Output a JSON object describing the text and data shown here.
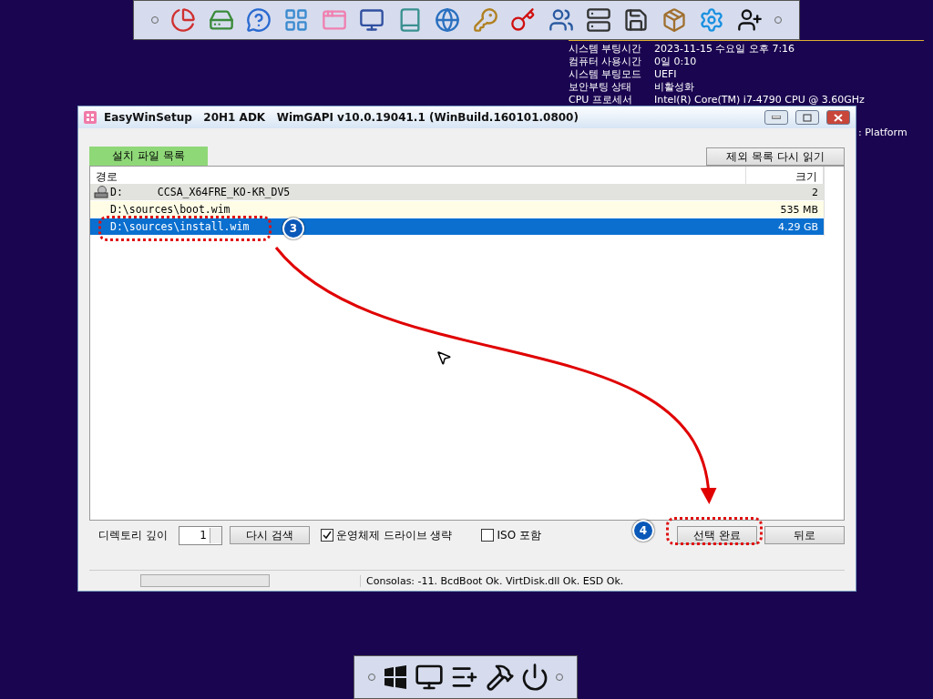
{
  "system_info": [
    {
      "label": "시스템 부팅시간",
      "value": "2023-11-15 수요일 오후 7:16"
    },
    {
      "label": "컴퓨터 사용시간",
      "value": "0일 0:10"
    },
    {
      "label": "시스템 부팅모드",
      "value": "UEFI"
    },
    {
      "label": "보안부팅 상태",
      "value": "비활성화"
    },
    {
      "label": "CPU 프로세서",
      "value": "Intel(R) Core(TM) i7-4790 CPU @ 3.60GHz"
    }
  ],
  "background_text": ": Platform",
  "window": {
    "title": "EasyWinSetup   20H1 ADK   WimGAPI v10.0.19041.1 (WinBuild.160101.0800)",
    "tab": {
      "label": "설치 파일 목록",
      "selected": true
    },
    "reload_button": "제외 목록 다시 읽기",
    "table": {
      "columns": [
        "경로",
        "크기"
      ],
      "rows": [
        {
          "kind": "drive",
          "path": "D:",
          "volume": "CCSA_X64FRE_KO-KR_DV5",
          "size": "2",
          "selected": false
        },
        {
          "kind": "file",
          "path": "D:\\sources\\boot.wim",
          "size": "535 MB",
          "selected": false
        },
        {
          "kind": "file",
          "path": "D:\\sources\\install.wim",
          "size": "4.29 GB",
          "selected": true,
          "annotation": "3"
        }
      ]
    },
    "depth": {
      "label": "디렉토리 깊이",
      "value": "1"
    },
    "rescan_button": "다시 검색",
    "checkboxes": [
      {
        "label": "운영체제 드라이브 생략",
        "checked": true
      },
      {
        "label": "ISO 포함",
        "checked": false
      }
    ],
    "buttons": [
      {
        "label": "선택 완료",
        "annotation": "4"
      },
      {
        "label": "뒤로"
      }
    ],
    "status_bar": {
      "progress": {
        "level": 0
      },
      "text": "Consolas: -11. BcdBoot Ok. VirtDisk.dll Ok. ESD Ok."
    }
  }
}
